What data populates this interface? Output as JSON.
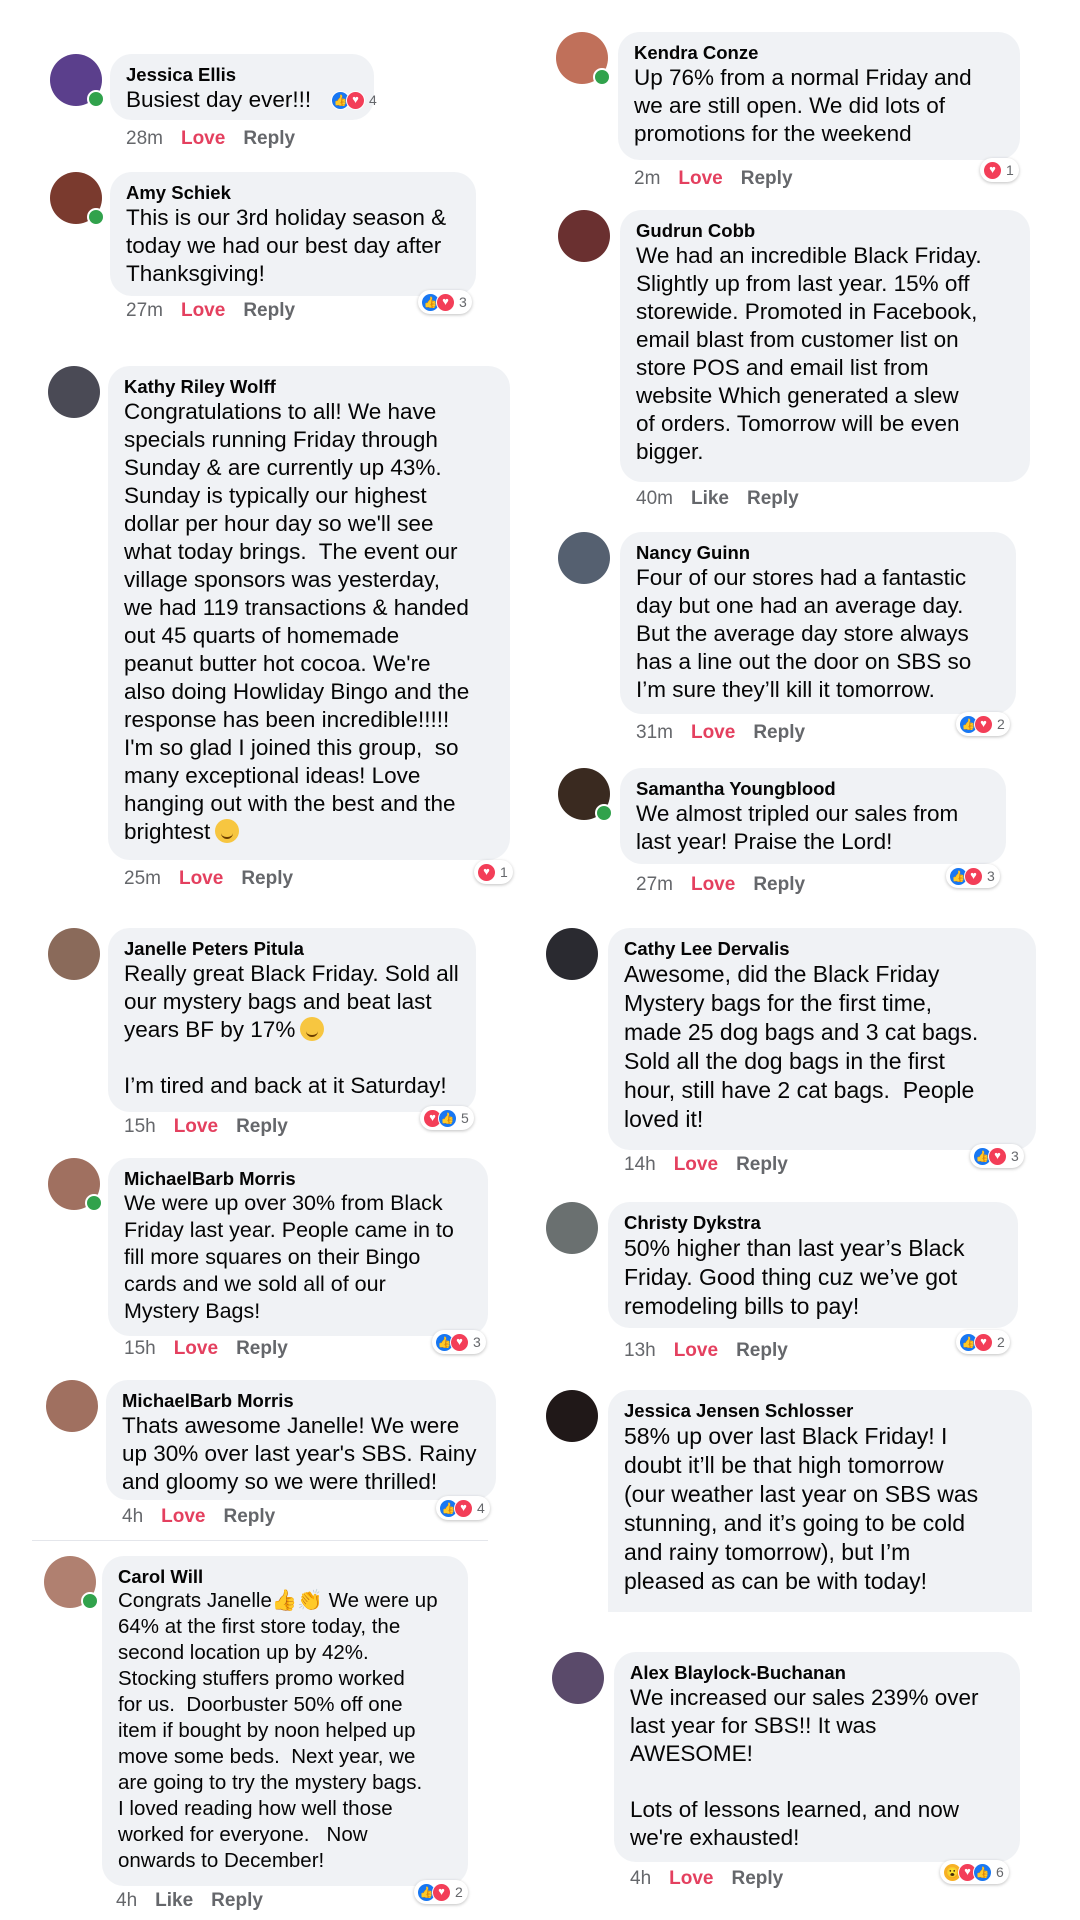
{
  "colors": {
    "bubble": "#f0f2f5",
    "love": "#e4405f",
    "like_blue": "#1877f2",
    "online": "#31a24c",
    "meta": "#65676b"
  },
  "comments": [
    {
      "name": "Jessica Ellis",
      "text": "Busiest day ever!!!",
      "time": "28m",
      "action": "Love",
      "reply": "Reply",
      "reactions": [
        "like",
        "love"
      ],
      "count": "4",
      "avatar_color": "#5b3f8c",
      "online": true
    },
    {
      "name": "Amy Schiek",
      "text": "This is our 3rd holiday season &\ntoday we had our best day after\nThanksgiving!",
      "time": "27m",
      "action": "Love",
      "reply": "Reply",
      "reactions": [
        "like",
        "love"
      ],
      "count": "3",
      "avatar_color": "#7a3a2e",
      "online": true
    },
    {
      "name": "Kathy Riley Wolff",
      "text": "Congratulations to all! We have\nspecials running Friday through\nSunday & are currently up 43%.\nSunday is typically our highest\ndollar per hour day so we'll see\nwhat today brings.  The event our\nvillage sponsors was yesterday,\nwe had 119 transactions & handed\nout 45 quarts of homemade\npeanut butter hot cocoa. We're\nalso doing Howliday Bingo and the\nresponse has been incredible!!!!!\nI'm so glad I joined this group,  so\nmany exceptional ideas! Love\nhanging out with the best and the\nbrightest",
      "time": "25m",
      "action": "Love",
      "reply": "Reply",
      "reactions": [
        "love"
      ],
      "count": "1",
      "avatar_color": "#4a4a55",
      "online": false
    },
    {
      "name": "Janelle Peters Pitula",
      "text": "Really great Black Friday. Sold all\nour mystery bags and beat last\nyears BF by 17%",
      "text2": "I’m tired and back at it Saturday!",
      "time": "15h",
      "action": "Love",
      "reply": "Reply",
      "reactions": [
        "love",
        "like"
      ],
      "count": "5",
      "avatar_color": "#8a6a5a",
      "online": false
    },
    {
      "name": "MichaelBarb Morris",
      "text": "We were up over 30% from Black\nFriday last year. People came in to\nfill more squares on their Bingo\ncards and we sold all of our\nMystery Bags!",
      "time": "15h",
      "action": "Love",
      "reply": "Reply",
      "reactions": [
        "like",
        "love"
      ],
      "count": "3",
      "avatar_color": "#a07060",
      "online": true
    },
    {
      "name": "MichaelBarb Morris",
      "text": "Thats awesome Janelle! We were\nup 30% over last year's SBS. Rainy\nand gloomy so we were thrilled!",
      "time": "4h",
      "action": "Love",
      "reply": "Reply",
      "reactions": [
        "like",
        "love"
      ],
      "count": "4",
      "avatar_color": "#a07060",
      "online": false
    },
    {
      "name": "Carol Will",
      "text": "Congrats Janelle👍👏 We were up\n64% at the first store today, the\nsecond location up by 42%.\nStocking stuffers promo worked\nfor us.  Doorbuster 50% off one\nitem if bought by noon helped up\nmove some beds.  Next year, we\nare going to try the mystery bags.\nI loved reading how well those\nworked for everyone.   Now\nonwards to December!",
      "time": "4h",
      "action": "Like",
      "reply": "Reply",
      "reactions": [
        "like",
        "love"
      ],
      "count": "2",
      "avatar_color": "#b08070",
      "online": true
    },
    {
      "name": "Kendra Conze",
      "text": "Up 76% from a normal Friday and\nwe are still open. We did lots of\npromotions for the weekend",
      "time": "2m",
      "action": "Love",
      "reply": "Reply",
      "reactions": [
        "love"
      ],
      "count": "1",
      "avatar_color": "#c0705a",
      "online": true
    },
    {
      "name": "Gudrun Cobb",
      "text": "We had an incredible Black Friday.\nSlightly up from last year. 15% off\nstorewide. Promoted in Facebook,\nemail blast from customer list on\nstore POS and email list from\nwebsite Which generated a slew\nof orders. Tomorrow will be even\nbigger.",
      "time": "40m",
      "action": "Like",
      "reply": "Reply",
      "reactions": [],
      "count": "",
      "avatar_color": "#6a3030",
      "online": false
    },
    {
      "name": "Nancy Guinn",
      "text": "Four of our stores had a fantastic\nday but one had an average day.\nBut the average day store always\nhas a line out the door on SBS so\nI’m sure they’ll kill it tomorrow.",
      "time": "31m",
      "action": "Love",
      "reply": "Reply",
      "reactions": [
        "like",
        "love"
      ],
      "count": "2",
      "avatar_color": "#556070",
      "online": false
    },
    {
      "name": "Samantha Youngblood",
      "text": "We almost tripled our sales from\nlast year! Praise the Lord!",
      "time": "27m",
      "action": "Love",
      "reply": "Reply",
      "reactions": [
        "like",
        "love"
      ],
      "count": "3",
      "avatar_color": "#3a2a20",
      "online": true
    },
    {
      "name": "Cathy Lee Dervalis",
      "text": "Awesome, did the Black Friday\nMystery bags for the first time,\nmade 25 dog bags and 3 cat bags.\nSold all the dog bags in the first\nhour, still have 2 cat bags.  People\nloved it!",
      "time": "14h",
      "action": "Love",
      "reply": "Reply",
      "reactions": [
        "like",
        "love"
      ],
      "count": "3",
      "avatar_color": "#2a2a30",
      "online": false
    },
    {
      "name": "Christy Dykstra",
      "text": "50% higher than last year’s Black\nFriday. Good thing cuz we’ve got\nremodeling bills to pay!",
      "time": "13h",
      "action": "Love",
      "reply": "Reply",
      "reactions": [
        "like",
        "love"
      ],
      "count": "2",
      "avatar_color": "#6a7070",
      "online": false
    },
    {
      "name": "Jessica Jensen Schlosser",
      "text": "58% up over last Black Friday! I\ndoubt it’ll be that high tomorrow\n(our weather last year on SBS was\nstunning, and it’s going to be cold\nand rainy tomorrow), but I’m\npleased as can be with today!",
      "time": "",
      "action": "",
      "reply": "",
      "reactions": [],
      "count": "",
      "avatar_color": "#201818",
      "online": false
    },
    {
      "name": "Alex Blaylock-Buchanan",
      "text": "We increased our sales 239% over\nlast year for SBS!! It was\nAWESOME!\n\nLots of lessons learned, and now\nwe're exhausted!",
      "time": "4h",
      "action": "Love",
      "reply": "Reply",
      "reactions": [
        "wow",
        "love",
        "like"
      ],
      "count": "6",
      "avatar_color": "#5a4a6a",
      "online": false
    }
  ]
}
